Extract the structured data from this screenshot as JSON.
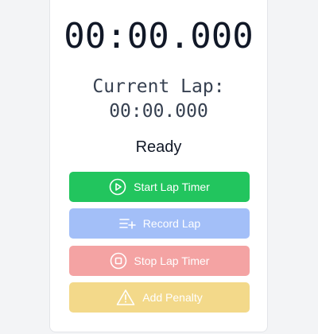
{
  "timer": {
    "main_time": "00:00.000",
    "current_lap_label": "Current Lap:",
    "current_lap_time": "00:00.000",
    "status": "Ready"
  },
  "buttons": {
    "start": {
      "label": "Start Lap Timer",
      "icon": "play-circle-icon",
      "color": "#22c55e"
    },
    "record": {
      "label": "Record Lap",
      "icon": "list-plus-icon",
      "color": "#a3bff8"
    },
    "stop": {
      "label": "Stop Lap Timer",
      "icon": "stop-circle-icon",
      "color": "#f4a3a3"
    },
    "penalty": {
      "label": "Add Penalty",
      "icon": "warning-icon",
      "color": "#f3d98a"
    }
  }
}
